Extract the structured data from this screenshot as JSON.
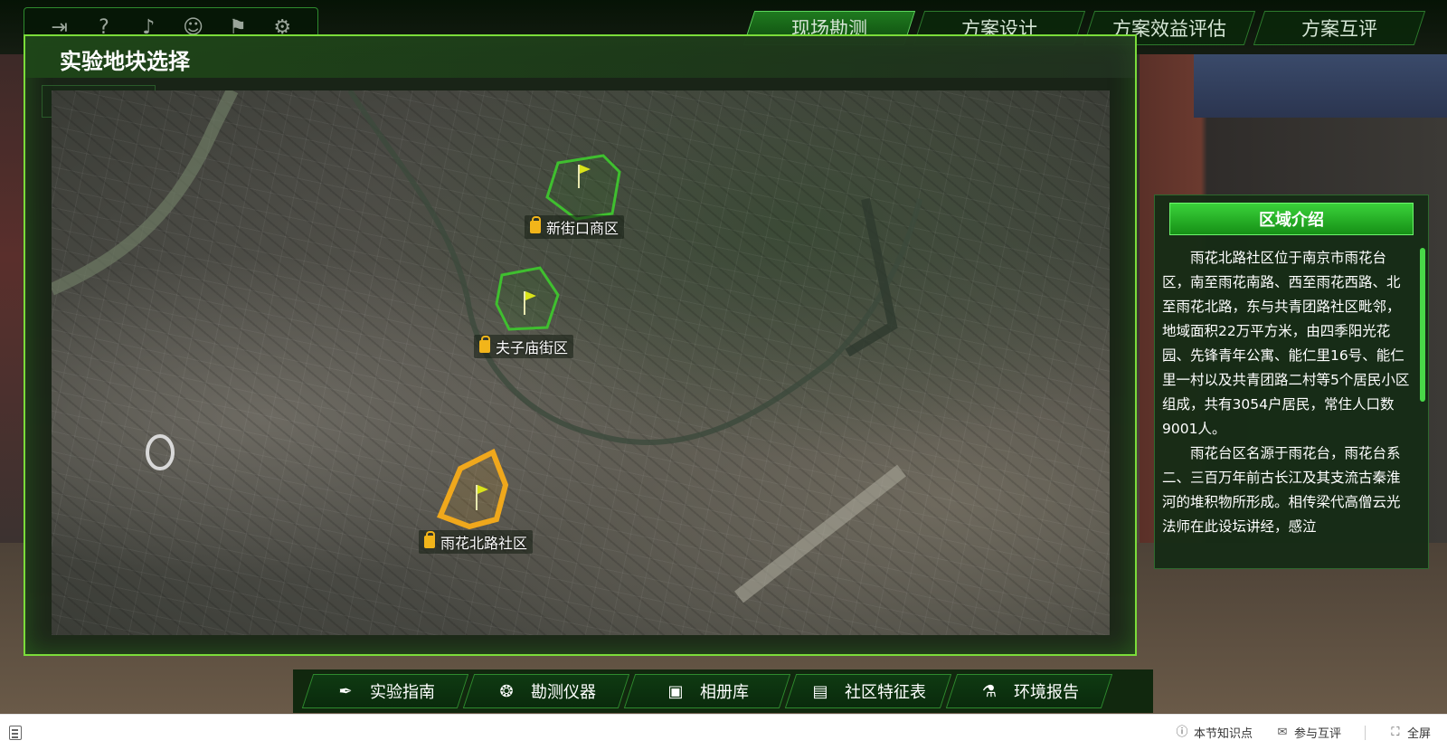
{
  "app": {
    "top_icons": [
      "exit-icon",
      "help-icon",
      "music-icon",
      "user-icon",
      "signpost-icon",
      "settings-icon"
    ]
  },
  "tabs": [
    {
      "label": "现场勘测",
      "active": true
    },
    {
      "label": "方案设计",
      "active": false
    },
    {
      "label": "方案效益评估",
      "active": false
    },
    {
      "label": "方案互评",
      "active": false
    }
  ],
  "panel": {
    "title": "实验地块选择"
  },
  "map": {
    "regions": [
      {
        "name": "新街口商区",
        "status": "locked",
        "outline_color": "#3fbf2f"
      },
      {
        "name": "夫子庙街区",
        "status": "locked",
        "outline_color": "#3fbf2f"
      },
      {
        "name": "雨花北路社区",
        "status": "selected",
        "outline_color": "#f0a81c"
      }
    ]
  },
  "intro": {
    "heading": "区域介绍",
    "paragraphs": [
      "雨花北路社区位于南京市雨花台区，南至雨花南路、西至雨花西路、北至雨花北路，东与共青团路社区毗邻，地域面积22万平方米，由四季阳光花园、先锋青年公寓、能仁里16号、能仁里一村以及共青团路二村等5个居民小区组成，共有3054户居民，常住人口数9001人。",
      "雨花台区名源于雨花台，雨花台系二、三百万年前古长江及其支流古秦淮河的堆积物所形成。相传梁代高僧云光法师在此设坛讲经，感泣"
    ]
  },
  "bottom_toolbar": [
    {
      "label": "实验指南",
      "icon": "pen-icon"
    },
    {
      "label": "勘测仪器",
      "icon": "instruments-icon"
    },
    {
      "label": "相册库",
      "icon": "image-icon"
    },
    {
      "label": "社区特征表",
      "icon": "table-icon"
    },
    {
      "label": "环境报告",
      "icon": "microscope-icon"
    }
  ],
  "footer": {
    "items": [
      {
        "label": "本节知识点",
        "icon": "info-icon"
      },
      {
        "label": "参与互评",
        "icon": "comment-icon"
      },
      {
        "label": "全屏",
        "icon": "fullscreen-icon"
      }
    ]
  },
  "colors": {
    "accent": "#7bdc3a",
    "tab_active": "#1f7a1f",
    "selected_region": "#f0a81c",
    "locked_region": "#3fbf2f"
  }
}
